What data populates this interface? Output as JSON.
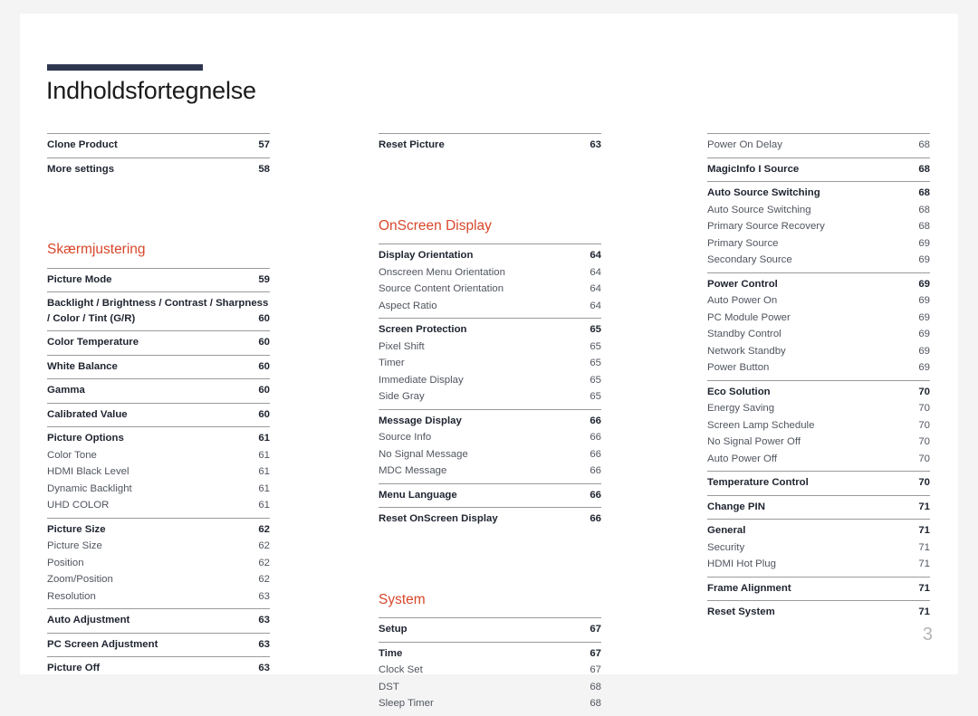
{
  "document": {
    "title": "Indholdsfortegnelse",
    "folio": "3",
    "accent_color": "#d8472b",
    "rule_color": "#2e3650"
  },
  "columns": [
    {
      "id": "column-1",
      "blocks": [
        {
          "type": "group",
          "rows": [
            {
              "label": "Clone Product",
              "page": "57",
              "level": "main"
            }
          ]
        },
        {
          "type": "group",
          "rows": [
            {
              "label": "More settings",
              "page": "58",
              "level": "main"
            }
          ]
        },
        {
          "type": "spacer",
          "size": "lg"
        },
        {
          "type": "heading",
          "label": "Skærmjustering"
        },
        {
          "type": "group",
          "rows": [
            {
              "label": "Picture Mode",
              "page": "59",
              "level": "main"
            }
          ]
        },
        {
          "type": "group",
          "rows": [
            {
              "label": "Backlight / Brightness / Contrast / Sharpness / Color / Tint (G/R)",
              "page": "60",
              "level": "main",
              "wrap": true
            }
          ]
        },
        {
          "type": "group",
          "rows": [
            {
              "label": "Color Temperature",
              "page": "60",
              "level": "main"
            }
          ]
        },
        {
          "type": "group",
          "rows": [
            {
              "label": "White Balance",
              "page": "60",
              "level": "main"
            }
          ]
        },
        {
          "type": "group",
          "rows": [
            {
              "label": "Gamma",
              "page": "60",
              "level": "main"
            }
          ]
        },
        {
          "type": "group",
          "rows": [
            {
              "label": "Calibrated Value",
              "page": "60",
              "level": "main"
            }
          ]
        },
        {
          "type": "group",
          "rows": [
            {
              "label": "Picture Options",
              "page": "61",
              "level": "main"
            },
            {
              "label": "Color Tone",
              "page": "61",
              "level": "sub"
            },
            {
              "label": "HDMI Black Level",
              "page": "61",
              "level": "sub"
            },
            {
              "label": "Dynamic Backlight",
              "page": "61",
              "level": "sub"
            },
            {
              "label": "UHD COLOR",
              "page": "61",
              "level": "sub"
            }
          ]
        },
        {
          "type": "group",
          "rows": [
            {
              "label": "Picture Size",
              "page": "62",
              "level": "main"
            },
            {
              "label": "Picture Size",
              "page": "62",
              "level": "sub"
            },
            {
              "label": "Position",
              "page": "62",
              "level": "sub"
            },
            {
              "label": "Zoom/Position",
              "page": "62",
              "level": "sub"
            },
            {
              "label": "Resolution",
              "page": "63",
              "level": "sub"
            }
          ]
        },
        {
          "type": "group",
          "rows": [
            {
              "label": "Auto Adjustment",
              "page": "63",
              "level": "main"
            }
          ]
        },
        {
          "type": "group",
          "rows": [
            {
              "label": "PC Screen Adjustment",
              "page": "63",
              "level": "main"
            }
          ]
        },
        {
          "type": "group",
          "rows": [
            {
              "label": "Picture Off",
              "page": "63",
              "level": "main"
            }
          ]
        }
      ]
    },
    {
      "id": "column-2",
      "blocks": [
        {
          "type": "group",
          "rows": [
            {
              "label": "Reset Picture",
              "page": "63",
              "level": "main"
            }
          ]
        },
        {
          "type": "spacer",
          "size": "lg"
        },
        {
          "type": "heading",
          "label": "OnScreen Display"
        },
        {
          "type": "group",
          "rows": [
            {
              "label": "Display Orientation",
              "page": "64",
              "level": "main"
            },
            {
              "label": "Onscreen Menu Orientation",
              "page": "64",
              "level": "sub"
            },
            {
              "label": "Source Content Orientation",
              "page": "64",
              "level": "sub"
            },
            {
              "label": "Aspect Ratio",
              "page": "64",
              "level": "sub"
            }
          ]
        },
        {
          "type": "group",
          "rows": [
            {
              "label": "Screen Protection",
              "page": "65",
              "level": "main"
            },
            {
              "label": "Pixel Shift",
              "page": "65",
              "level": "sub"
            },
            {
              "label": "Timer",
              "page": "65",
              "level": "sub"
            },
            {
              "label": "Immediate Display",
              "page": "65",
              "level": "sub"
            },
            {
              "label": "Side Gray",
              "page": "65",
              "level": "sub"
            }
          ]
        },
        {
          "type": "group",
          "rows": [
            {
              "label": "Message Display",
              "page": "66",
              "level": "main"
            },
            {
              "label": "Source Info",
              "page": "66",
              "level": "sub"
            },
            {
              "label": "No Signal Message",
              "page": "66",
              "level": "sub"
            },
            {
              "label": "MDC Message",
              "page": "66",
              "level": "sub"
            }
          ]
        },
        {
          "type": "group",
          "rows": [
            {
              "label": "Menu Language",
              "page": "66",
              "level": "main"
            }
          ]
        },
        {
          "type": "group",
          "rows": [
            {
              "label": "Reset OnScreen Display",
              "page": "66",
              "level": "main"
            }
          ]
        },
        {
          "type": "spacer",
          "size": "lg"
        },
        {
          "type": "heading",
          "label": "System"
        },
        {
          "type": "group",
          "rows": [
            {
              "label": "Setup",
              "page": "67",
              "level": "main"
            }
          ]
        },
        {
          "type": "group",
          "rows": [
            {
              "label": "Time",
              "page": "67",
              "level": "main"
            },
            {
              "label": "Clock Set",
              "page": "67",
              "level": "sub"
            },
            {
              "label": "DST",
              "page": "68",
              "level": "sub"
            },
            {
              "label": "Sleep Timer",
              "page": "68",
              "level": "sub"
            }
          ]
        }
      ]
    },
    {
      "id": "column-3",
      "blocks": [
        {
          "type": "group",
          "rows": [
            {
              "label": "Power On Delay",
              "page": "68",
              "level": "sub"
            }
          ]
        },
        {
          "type": "group",
          "rows": [
            {
              "label": "MagicInfo I Source",
              "page": "68",
              "level": "main"
            }
          ]
        },
        {
          "type": "group",
          "rows": [
            {
              "label": "Auto Source Switching",
              "page": "68",
              "level": "main"
            },
            {
              "label": "Auto Source Switching",
              "page": "68",
              "level": "sub"
            },
            {
              "label": "Primary Source Recovery",
              "page": "68",
              "level": "sub"
            },
            {
              "label": "Primary Source",
              "page": "69",
              "level": "sub"
            },
            {
              "label": "Secondary Source",
              "page": "69",
              "level": "sub"
            }
          ]
        },
        {
          "type": "group",
          "rows": [
            {
              "label": "Power Control",
              "page": "69",
              "level": "main"
            },
            {
              "label": "Auto Power On",
              "page": "69",
              "level": "sub"
            },
            {
              "label": "PC Module Power",
              "page": "69",
              "level": "sub"
            },
            {
              "label": "Standby Control",
              "page": "69",
              "level": "sub"
            },
            {
              "label": "Network Standby",
              "page": "69",
              "level": "sub"
            },
            {
              "label": "Power Button",
              "page": "69",
              "level": "sub"
            }
          ]
        },
        {
          "type": "group",
          "rows": [
            {
              "label": "Eco Solution",
              "page": "70",
              "level": "main"
            },
            {
              "label": "Energy Saving",
              "page": "70",
              "level": "sub"
            },
            {
              "label": "Screen Lamp Schedule",
              "page": "70",
              "level": "sub"
            },
            {
              "label": "No Signal Power Off",
              "page": "70",
              "level": "sub"
            },
            {
              "label": "Auto Power Off",
              "page": "70",
              "level": "sub"
            }
          ]
        },
        {
          "type": "group",
          "rows": [
            {
              "label": "Temperature Control",
              "page": "70",
              "level": "main"
            }
          ]
        },
        {
          "type": "group",
          "rows": [
            {
              "label": "Change PIN",
              "page": "71",
              "level": "main"
            }
          ]
        },
        {
          "type": "group",
          "rows": [
            {
              "label": "General",
              "page": "71",
              "level": "main"
            },
            {
              "label": "Security",
              "page": "71",
              "level": "sub"
            },
            {
              "label": "HDMI Hot Plug",
              "page": "71",
              "level": "sub"
            }
          ]
        },
        {
          "type": "group",
          "rows": [
            {
              "label": "Frame Alignment",
              "page": "71",
              "level": "main"
            }
          ]
        },
        {
          "type": "group",
          "rows": [
            {
              "label": "Reset System",
              "page": "71",
              "level": "main"
            }
          ]
        }
      ]
    }
  ]
}
